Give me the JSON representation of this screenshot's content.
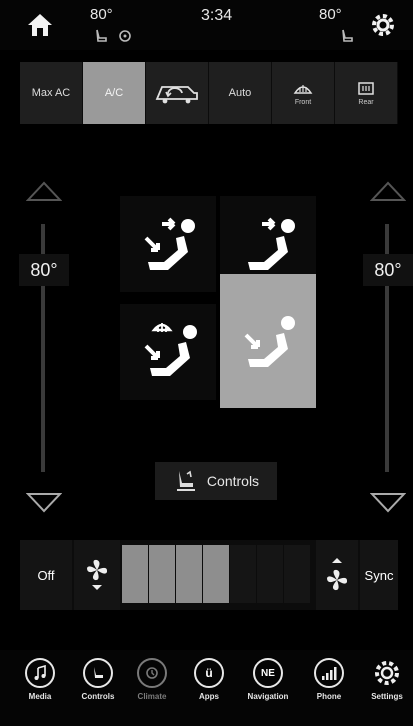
{
  "status_bar": {
    "left_temp": "80°",
    "time": "3:34",
    "right_temp": "80°"
  },
  "mode_row": {
    "buttons": [
      {
        "label": "Max AC",
        "active": false
      },
      {
        "label": "A/C",
        "active": true
      },
      {
        "label": "",
        "icon": "recirculation-icon",
        "active": false
      },
      {
        "label": "Auto",
        "active": false
      },
      {
        "label": "Front",
        "icon": "front-defrost-icon",
        "active": false
      },
      {
        "label": "Rear",
        "icon": "rear-defrost-icon",
        "active": false
      }
    ]
  },
  "driver_temp": {
    "value": "80°",
    "level": 0.5
  },
  "passenger_temp": {
    "value": "80°",
    "level": 0.5
  },
  "airflow_modes": [
    {
      "icon": "panel-floor-icon",
      "active": false
    },
    {
      "icon": "panel-icon",
      "active": false
    },
    {
      "icon": "defrost-floor-icon",
      "active": false
    },
    {
      "icon": "floor-icon",
      "active": true
    }
  ],
  "controls_button": {
    "label": "Controls"
  },
  "fan": {
    "off_label": "Off",
    "sync_label": "Sync",
    "level": 4,
    "max_level": 7
  },
  "nav": [
    {
      "label": "Media",
      "icon": "music-note-icon",
      "active": true
    },
    {
      "label": "Controls",
      "icon": "controls-icon",
      "active": true
    },
    {
      "label": "Climate",
      "icon": "climate-icon",
      "active": false
    },
    {
      "label": "Apps",
      "icon": "apps-icon",
      "glyph": "ü",
      "active": true
    },
    {
      "label": "Navigation",
      "icon": "compass-icon",
      "glyph": "NE",
      "active": true
    },
    {
      "label": "Phone",
      "icon": "signal-bars-icon",
      "active": true
    },
    {
      "label": "Settings",
      "icon": "gear-icon",
      "active": true
    }
  ]
}
